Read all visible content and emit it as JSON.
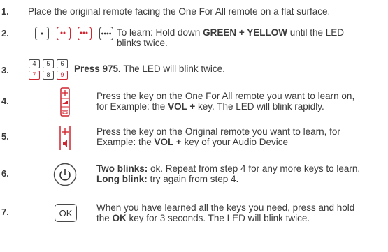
{
  "colors": {
    "accent": "#d1242f",
    "text": "#3a3a3a",
    "key_outline": "#4a4a4a"
  },
  "steps": [
    {
      "number": "1.",
      "text": "Place the original remote facing the One For All remote on a flat surface."
    },
    {
      "number": "2.",
      "pre": "To learn: Hold down ",
      "bold": "GREEN + YELLOW",
      "post": " until the LED",
      "line2": "blinks twice.",
      "icons": [
        "one-dot-key-icon",
        "two-dot-key-icon",
        "three-dot-key-icon",
        "four-dot-key-icon"
      ]
    },
    {
      "number": "3.",
      "bold": "Press 975.",
      "post": " The LED will blink twice.",
      "keys": [
        "4",
        "5",
        "6",
        "7",
        "8",
        "9"
      ]
    },
    {
      "number": "4.",
      "line1": "Press the key on the One For All remote you want to learn on,",
      "pre2": "for Example: the ",
      "bold2": "VOL +",
      "post2": " key. The LED will blink rapidly.",
      "icon": "volume-rocker-icon"
    },
    {
      "number": "5.",
      "line1": "Press the key on the Original remote you want to learn, for",
      "pre2": "Example: the ",
      "bold2": "VOL +",
      "post2": " key of your Audio Device",
      "icon": "volume-up-key-icon"
    },
    {
      "number": "6.",
      "bold1": "Two blinks:",
      "post1": " ok. Repeat from step 4 for any more keys to learn.",
      "bold2": "Long blink:",
      "post2": " try again from step 4.",
      "icon": "power-icon"
    },
    {
      "number": "7.",
      "line1": "When you have learned all the keys you need, press and hold",
      "pre2": "the ",
      "bold2": "OK",
      "post2": " key for 3 seconds. The LED will blink twice.",
      "ok_label": "OK"
    }
  ]
}
